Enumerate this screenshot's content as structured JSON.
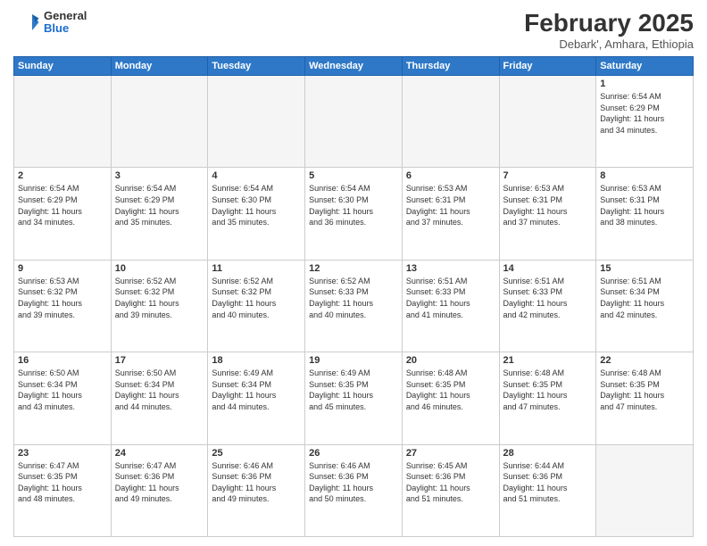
{
  "header": {
    "logo_general": "General",
    "logo_blue": "Blue",
    "month_title": "February 2025",
    "location": "Debark', Amhara, Ethiopia"
  },
  "days_of_week": [
    "Sunday",
    "Monday",
    "Tuesday",
    "Wednesday",
    "Thursday",
    "Friday",
    "Saturday"
  ],
  "weeks": [
    [
      {
        "day": "",
        "info": ""
      },
      {
        "day": "",
        "info": ""
      },
      {
        "day": "",
        "info": ""
      },
      {
        "day": "",
        "info": ""
      },
      {
        "day": "",
        "info": ""
      },
      {
        "day": "",
        "info": ""
      },
      {
        "day": "1",
        "info": "Sunrise: 6:54 AM\nSunset: 6:29 PM\nDaylight: 11 hours\nand 34 minutes."
      }
    ],
    [
      {
        "day": "2",
        "info": "Sunrise: 6:54 AM\nSunset: 6:29 PM\nDaylight: 11 hours\nand 34 minutes."
      },
      {
        "day": "3",
        "info": "Sunrise: 6:54 AM\nSunset: 6:29 PM\nDaylight: 11 hours\nand 35 minutes."
      },
      {
        "day": "4",
        "info": "Sunrise: 6:54 AM\nSunset: 6:30 PM\nDaylight: 11 hours\nand 35 minutes."
      },
      {
        "day": "5",
        "info": "Sunrise: 6:54 AM\nSunset: 6:30 PM\nDaylight: 11 hours\nand 36 minutes."
      },
      {
        "day": "6",
        "info": "Sunrise: 6:53 AM\nSunset: 6:31 PM\nDaylight: 11 hours\nand 37 minutes."
      },
      {
        "day": "7",
        "info": "Sunrise: 6:53 AM\nSunset: 6:31 PM\nDaylight: 11 hours\nand 37 minutes."
      },
      {
        "day": "8",
        "info": "Sunrise: 6:53 AM\nSunset: 6:31 PM\nDaylight: 11 hours\nand 38 minutes."
      }
    ],
    [
      {
        "day": "9",
        "info": "Sunrise: 6:53 AM\nSunset: 6:32 PM\nDaylight: 11 hours\nand 39 minutes."
      },
      {
        "day": "10",
        "info": "Sunrise: 6:52 AM\nSunset: 6:32 PM\nDaylight: 11 hours\nand 39 minutes."
      },
      {
        "day": "11",
        "info": "Sunrise: 6:52 AM\nSunset: 6:32 PM\nDaylight: 11 hours\nand 40 minutes."
      },
      {
        "day": "12",
        "info": "Sunrise: 6:52 AM\nSunset: 6:33 PM\nDaylight: 11 hours\nand 40 minutes."
      },
      {
        "day": "13",
        "info": "Sunrise: 6:51 AM\nSunset: 6:33 PM\nDaylight: 11 hours\nand 41 minutes."
      },
      {
        "day": "14",
        "info": "Sunrise: 6:51 AM\nSunset: 6:33 PM\nDaylight: 11 hours\nand 42 minutes."
      },
      {
        "day": "15",
        "info": "Sunrise: 6:51 AM\nSunset: 6:34 PM\nDaylight: 11 hours\nand 42 minutes."
      }
    ],
    [
      {
        "day": "16",
        "info": "Sunrise: 6:50 AM\nSunset: 6:34 PM\nDaylight: 11 hours\nand 43 minutes."
      },
      {
        "day": "17",
        "info": "Sunrise: 6:50 AM\nSunset: 6:34 PM\nDaylight: 11 hours\nand 44 minutes."
      },
      {
        "day": "18",
        "info": "Sunrise: 6:49 AM\nSunset: 6:34 PM\nDaylight: 11 hours\nand 44 minutes."
      },
      {
        "day": "19",
        "info": "Sunrise: 6:49 AM\nSunset: 6:35 PM\nDaylight: 11 hours\nand 45 minutes."
      },
      {
        "day": "20",
        "info": "Sunrise: 6:48 AM\nSunset: 6:35 PM\nDaylight: 11 hours\nand 46 minutes."
      },
      {
        "day": "21",
        "info": "Sunrise: 6:48 AM\nSunset: 6:35 PM\nDaylight: 11 hours\nand 47 minutes."
      },
      {
        "day": "22",
        "info": "Sunrise: 6:48 AM\nSunset: 6:35 PM\nDaylight: 11 hours\nand 47 minutes."
      }
    ],
    [
      {
        "day": "23",
        "info": "Sunrise: 6:47 AM\nSunset: 6:35 PM\nDaylight: 11 hours\nand 48 minutes."
      },
      {
        "day": "24",
        "info": "Sunrise: 6:47 AM\nSunset: 6:36 PM\nDaylight: 11 hours\nand 49 minutes."
      },
      {
        "day": "25",
        "info": "Sunrise: 6:46 AM\nSunset: 6:36 PM\nDaylight: 11 hours\nand 49 minutes."
      },
      {
        "day": "26",
        "info": "Sunrise: 6:46 AM\nSunset: 6:36 PM\nDaylight: 11 hours\nand 50 minutes."
      },
      {
        "day": "27",
        "info": "Sunrise: 6:45 AM\nSunset: 6:36 PM\nDaylight: 11 hours\nand 51 minutes."
      },
      {
        "day": "28",
        "info": "Sunrise: 6:44 AM\nSunset: 6:36 PM\nDaylight: 11 hours\nand 51 minutes."
      },
      {
        "day": "",
        "info": ""
      }
    ]
  ]
}
